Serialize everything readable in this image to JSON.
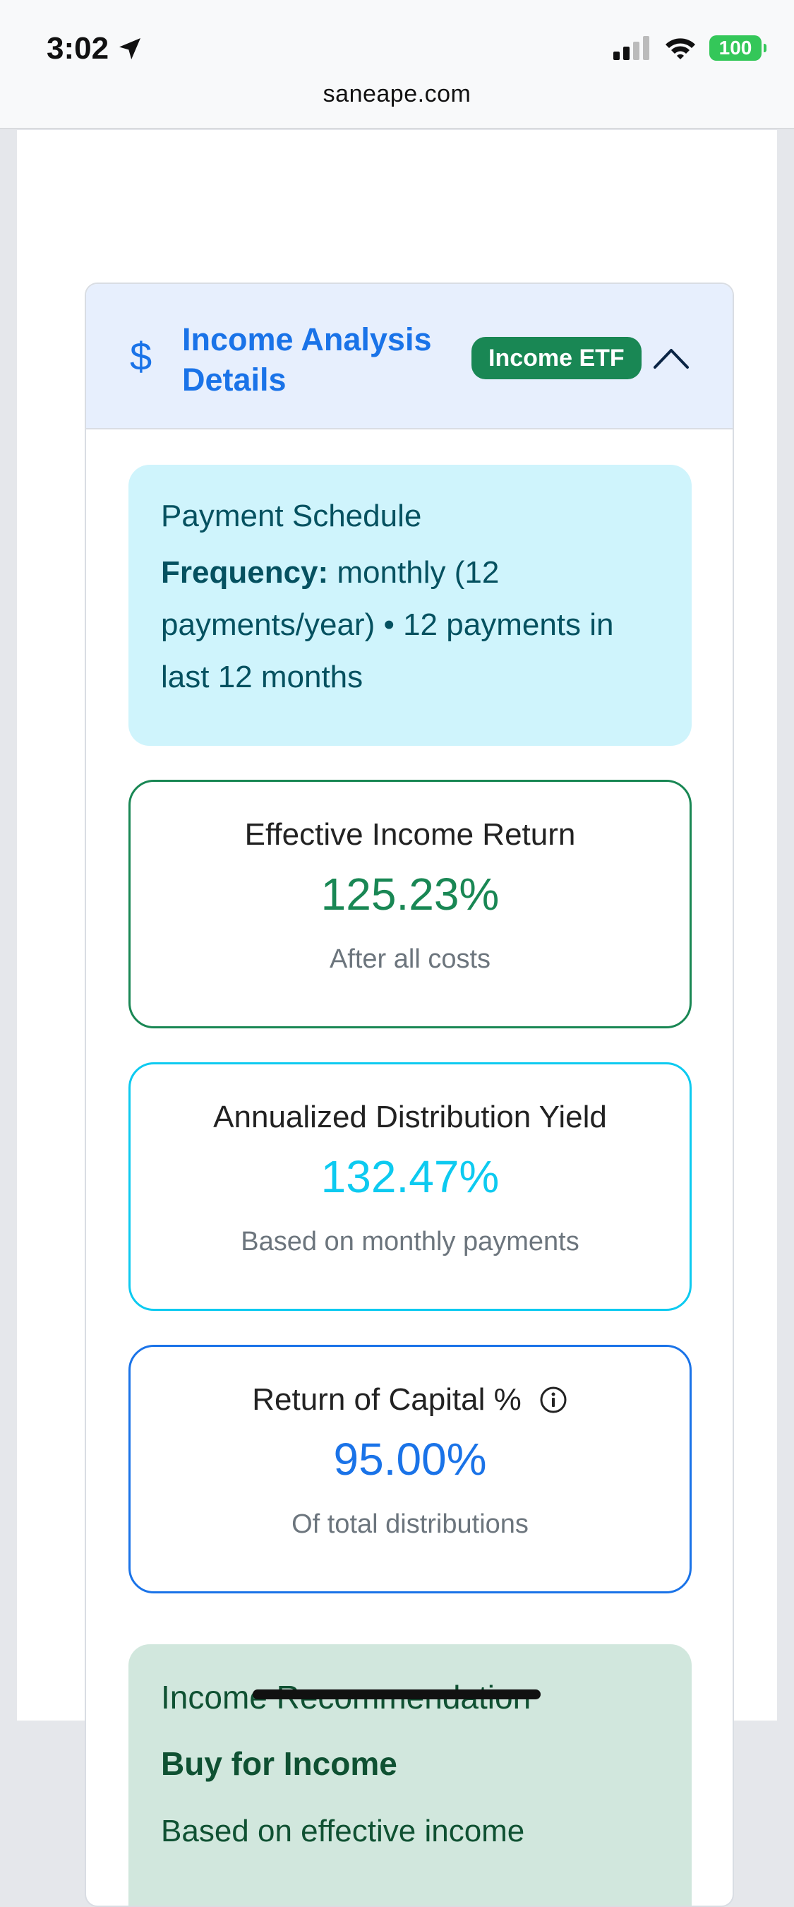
{
  "status_bar": {
    "time": "3:02",
    "battery": "100",
    "url": "saneape.com"
  },
  "header": {
    "icon": "dollar-icon",
    "title": "Income Analysis Details",
    "badge": "Income ETF",
    "badge_color": "#198754",
    "accent_color": "#1a73e8"
  },
  "schedule": {
    "title": "Payment Schedule",
    "frequency_label": "Frequency:",
    "frequency_text": "monthly (12 payments/year) • 12 payments in last 12 months"
  },
  "metrics": [
    {
      "label": "Effective Income Return",
      "value": "125.23%",
      "sub": "After all costs",
      "color": "#198754"
    },
    {
      "label": "Annualized Distribution Yield",
      "value": "132.47%",
      "sub": "Based on monthly payments",
      "color": "#0dcaf0"
    },
    {
      "label": "Return of Capital %",
      "value": "95.00%",
      "sub": "Of total distributions",
      "color": "#1a73e8"
    }
  ],
  "recommendation": {
    "title": "Income Recommendation",
    "value": "Buy for Income",
    "sub": "Based on effective income"
  }
}
